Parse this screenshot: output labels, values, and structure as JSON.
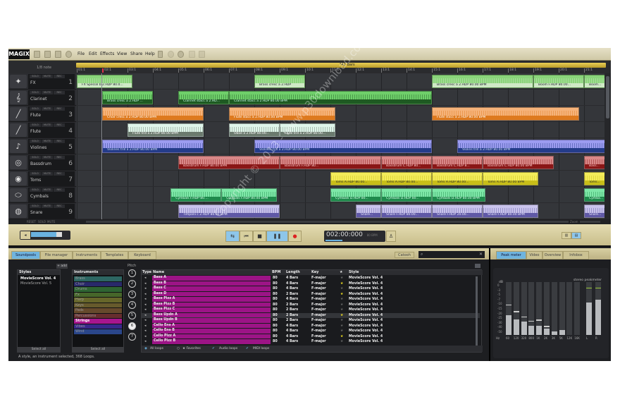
{
  "app": {
    "logo": "MAGIX",
    "menu": [
      "File",
      "Edit",
      "Effects",
      "View",
      "Share",
      "Help"
    ]
  },
  "ruler": {
    "grid_label": "1/8 note",
    "length_label": "*42 Bars",
    "ticks": [
      "01:1",
      "02:1",
      "03:1",
      "04:1",
      "05:1",
      "06:1",
      "07:1",
      "08:1",
      "09:1",
      "10:1",
      "11:1",
      "12:1",
      "13:1",
      "14:1",
      "15:1",
      "16:1",
      "17:1",
      "18:1",
      "19:1",
      "20:1",
      "21:1"
    ]
  },
  "track_buttons": {
    "solo": "SOLO",
    "mute": "MUTE",
    "rec": "REC"
  },
  "tracks": [
    {
      "num": "1",
      "name": "FX",
      "icon": "fx-icon",
      "glyph": "✦",
      "color": "#8ad47a",
      "label_color": "#cfe9c6",
      "text_color": "#223",
      "clips": [
        {
          "start": 0,
          "len": 2.2,
          "label": "FX Special b 2.HDP  80.0..."
        },
        {
          "start": 7,
          "len": 2,
          "label": "Brass cresc a 2.HDP"
        },
        {
          "start": 14,
          "len": 4,
          "label": "Brass cresc a 2.HDP  80.00 BPM"
        },
        {
          "start": 18,
          "len": 2,
          "label": "Boom F.HDP  80.00..."
        },
        {
          "start": 20,
          "len": 1,
          "label": "Boom..."
        }
      ]
    },
    {
      "num": "2",
      "name": "Clarinet",
      "icon": "clarinet-icon",
      "glyph": "𝄞",
      "color": "#6fcf6a",
      "label_color": "#1e5a22",
      "text_color": "#cfe",
      "clips": [
        {
          "start": 1,
          "len": 2,
          "label": "Brass cresc a 2.HDP ..."
        },
        {
          "start": 4,
          "len": 2,
          "label": "Clarinet stacc a 2.HD..."
        },
        {
          "start": 6,
          "len": 8,
          "label": "Clarinet stacc a 2.HDP  80.00 BPM"
        }
      ]
    },
    {
      "num": "3",
      "name": "Flute",
      "icon": "flute-icon",
      "glyph": "╱",
      "color": "#f6b37a",
      "label_color": "#de7a1e",
      "text_color": "#fff",
      "clips": [
        {
          "start": 1,
          "len": 4,
          "label": "Choir cresc a 2.HDP  80.00 BPM"
        },
        {
          "start": 6,
          "len": 4.2,
          "label": "Flute stacc a 2.HDP  80.00 BPM"
        },
        {
          "start": 14,
          "len": 5.8,
          "label": "Flute stacc a 2.HDP  80.00 BPM"
        }
      ]
    },
    {
      "num": "4",
      "name": "Flute",
      "icon": "flute-icon",
      "glyph": "╱",
      "color": "#dff5ea",
      "label_color": "#6b7a6e",
      "text_color": "#fff",
      "clips": [
        {
          "start": 2,
          "len": 3,
          "label": "Flute trill a 2.HDP  80.00 BPM"
        },
        {
          "start": 6,
          "len": 2,
          "label": "Oboe a 2.HDP  80.00..."
        },
        {
          "start": 8,
          "len": 2.2,
          "label": "Flute trill a 2.HDP  80.00..."
        }
      ]
    },
    {
      "num": "5",
      "name": "Violines",
      "icon": "violin-icon",
      "glyph": "♪",
      "color": "#9c9cf0",
      "label_color": "#243c8a",
      "text_color": "#cde",
      "clips": [
        {
          "start": 1,
          "len": 4,
          "label": "Violines trill a 2.HDP  80.00 BPM"
        },
        {
          "start": 7,
          "len": 7,
          "label": "Violines trill a 2.HDP  80.00 BPM"
        },
        {
          "start": 15,
          "len": 6,
          "label": "Violins trill a 2.HDP  80.00 BPM"
        }
      ]
    },
    {
      "num": "6",
      "name": "Bassdrum",
      "icon": "drumkit-icon",
      "glyph": "◎",
      "color": "#d98888",
      "label_color": "#8a1616",
      "text_color": "#fcc",
      "clips": [
        {
          "start": 4,
          "len": 4,
          "label": "Bassdrum F.HDP  80.00 BPM"
        },
        {
          "start": 8,
          "len": 4,
          "label": "Bassdrum F.HDP  80..."
        },
        {
          "start": 12,
          "len": 2,
          "label": "Bassdrum C.HDP  80..."
        },
        {
          "start": 14,
          "len": 2,
          "label": "Bassdrum C.HDP  8..."
        },
        {
          "start": 16,
          "len": 2.8,
          "label": "Bassdrum C.HDP  80.00 BPM"
        },
        {
          "start": 20,
          "len": 1,
          "label": "Bass..."
        }
      ]
    },
    {
      "num": "7",
      "name": "Toms",
      "icon": "tom-drum-icon",
      "glyph": "◉",
      "color": "#f3ec5a",
      "label_color": "#c8be18",
      "text_color": "#333",
      "clips": [
        {
          "start": 10,
          "len": 2,
          "label": "Toms A.HDP  80.00..."
        },
        {
          "start": 12,
          "len": 2,
          "label": "Toms A.HDP  80.00..."
        },
        {
          "start": 14,
          "len": 2,
          "label": "Toms A.HDP  80.00..."
        },
        {
          "start": 16,
          "len": 2.2,
          "label": "Toms A.HDP  80.00 BPM"
        },
        {
          "start": 20,
          "len": 1,
          "label": "Toms..."
        }
      ]
    },
    {
      "num": "8",
      "name": "Cymbals",
      "icon": "cymbal-icon",
      "glyph": "⬭",
      "color": "#7ee8a8",
      "label_color": "#1f8a4c",
      "text_color": "#dfe",
      "clips": [
        {
          "start": 3.7,
          "len": 2,
          "label": "Cymbals F.HDP  80...."
        },
        {
          "start": 5.7,
          "len": 2.2,
          "label": "Cymbals F.HDP  80.00 BPM"
        },
        {
          "start": 10,
          "len": 2,
          "label": "Cymbals D.HDP  80..."
        },
        {
          "start": 12,
          "len": 2,
          "label": "Cymbals D.HDP  80..."
        },
        {
          "start": 14,
          "len": 2.1,
          "label": "Cymbals D.HDP  80.00 BPM"
        },
        {
          "start": 20,
          "len": 1,
          "label": "Cymba..."
        }
      ]
    },
    {
      "num": "9",
      "name": "Snare",
      "icon": "snare-icon",
      "glyph": "◍",
      "color": "#c9c3ec",
      "label_color": "#5f58a6",
      "text_color": "#eef",
      "clips": [
        {
          "start": 4,
          "len": 4,
          "label": "Timpani c 2.HDP  80.00 BPM"
        },
        {
          "start": 11,
          "len": 1,
          "label": "Snare..."
        },
        {
          "start": 12,
          "len": 2,
          "label": "Snare F.HDP  80.00..."
        },
        {
          "start": 14,
          "len": 2,
          "label": "Snare F.HDP  20.00..."
        },
        {
          "start": 16,
          "len": 2.2,
          "label": "Snare F.HDP  80.00 BPM"
        },
        {
          "start": 20,
          "len": 1,
          "label": "Snare..."
        }
      ]
    }
  ],
  "arr_footer": {
    "reset": "RESET",
    "solo": "SOLO",
    "mute": "MUTE",
    "zoom": "Zoom"
  },
  "transport": {
    "time": "002:00:000",
    "bpm": "80 BPM"
  },
  "bottom_tabs": [
    "Soundpools",
    "File manager",
    "Instruments",
    "Templates",
    "Keyboard"
  ],
  "right_tabs": [
    "Peak meter",
    "Video",
    "Overview",
    "Infobox"
  ],
  "catooh": "Catooh",
  "search": {
    "placeholder": ""
  },
  "styles": {
    "header": "Styles",
    "add": "+ add",
    "items": [
      "MovieScore Vol. 4",
      "MovieScore Vol. 5"
    ],
    "select_all": "Select all"
  },
  "instruments": {
    "header": "Instruments",
    "select_all": "Select all",
    "items": [
      {
        "name": "Brass",
        "color": "#2d6662"
      },
      {
        "name": "Choir",
        "color": "#29296a"
      },
      {
        "name": "Drums",
        "color": "#2e6432"
      },
      {
        "name": "Fx",
        "color": "#46662a"
      },
      {
        "name": "Harp",
        "color": "#66662a"
      },
      {
        "name": "Keys",
        "color": "#665a2c"
      },
      {
        "name": "Pads",
        "color": "#664a2c"
      },
      {
        "name": "Percussions",
        "color": "#662e2e"
      },
      {
        "name": "Strings",
        "color": "#a8168e"
      },
      {
        "name": "Vibes",
        "color": "#38288a"
      },
      {
        "name": "Wind",
        "color": "#2a468a"
      }
    ],
    "selected": "Strings"
  },
  "pitch": {
    "label": "Pitch",
    "values": [
      "1",
      "2",
      "3",
      "4",
      "5",
      "6",
      "7"
    ],
    "selected": "6"
  },
  "loops_table": {
    "headers": {
      "type": "Type",
      "name": "Name",
      "bpm": "BPM",
      "length": "Length",
      "key": "Key",
      "fav": "★",
      "style": "Style"
    },
    "rows": [
      {
        "name": "Bass A",
        "bpm": "80",
        "length": "4 Bars",
        "key": "F-major",
        "fav": false,
        "style": "MovieScore Vol. 4"
      },
      {
        "name": "Bass B",
        "bpm": "80",
        "length": "4 Bars",
        "key": "F-major",
        "fav": true,
        "style": "MovieScore Vol. 4"
      },
      {
        "name": "Bass C",
        "bpm": "80",
        "length": "4 Bars",
        "key": "F-major",
        "fav": false,
        "style": "MovieScore Vol. 4"
      },
      {
        "name": "Bass D",
        "bpm": "80",
        "length": "2 Bars",
        "key": "F-major",
        "fav": true,
        "style": "MovieScore Vol. 4"
      },
      {
        "name": "Bass Pizz A",
        "bpm": "80",
        "length": "4 Bars",
        "key": "F-major",
        "fav": false,
        "style": "MovieScore Vol. 4"
      },
      {
        "name": "Bass Pizz B",
        "bpm": "80",
        "length": "2 Bars",
        "key": "F-major",
        "fav": false,
        "style": "MovieScore Vol. 4"
      },
      {
        "name": "Bass Pizz C",
        "bpm": "80",
        "length": "2 Bars",
        "key": "F-major",
        "fav": false,
        "style": "MovieScore Vol. 4"
      },
      {
        "name": "Bass Updn A",
        "bpm": "80",
        "length": "2 Bars",
        "key": "F-major",
        "fav": true,
        "style": "MovieScore Vol. 4",
        "selected": true
      },
      {
        "name": "Bass Updn B",
        "bpm": "80",
        "length": "2 Bars",
        "key": "F-major",
        "fav": false,
        "style": "MovieScore Vol. 4"
      },
      {
        "name": "Cello Ens A",
        "bpm": "80",
        "length": "4 Bars",
        "key": "F-major",
        "fav": false,
        "style": "MovieScore Vol. 4"
      },
      {
        "name": "Cello Ens B",
        "bpm": "80",
        "length": "4 Bars",
        "key": "F-major",
        "fav": false,
        "style": "MovieScore Vol. 4"
      },
      {
        "name": "Cello Pizz A",
        "bpm": "80",
        "length": "4 Bars",
        "key": "F-major",
        "fav": true,
        "style": "MovieScore Vol. 4"
      },
      {
        "name": "Cello Pizz B",
        "bpm": "80",
        "length": "4 Bars",
        "key": "F-major",
        "fav": false,
        "style": "MovieScore Vol. 4"
      }
    ],
    "filters": {
      "all_loops": "All loops",
      "favorites": "★ Favorites",
      "audio_loops": "Audio loops",
      "midi_loops": "MIDI loops"
    }
  },
  "status": "A style, an instrument selected, 368 Loops.",
  "peakmeter": {
    "title": "stereo peakmeter",
    "db_label": "dB",
    "hz_label": "Hz",
    "db_ticks": [
      "0",
      "-3",
      "-5",
      "-7",
      "-10",
      "-15",
      "-20",
      "-25",
      "-30",
      "-40",
      "-50"
    ],
    "bands": [
      {
        "label": "60",
        "level": 0.37,
        "peak": 0.58
      },
      {
        "label": "120",
        "level": 0.3,
        "peak": 0.45
      },
      {
        "label": "320",
        "level": 0.25,
        "peak": 0.35
      },
      {
        "label": "800",
        "level": 0.17,
        "peak": 0.27
      },
      {
        "label": "1K",
        "level": 0.18,
        "peak": 0.29
      },
      {
        "label": "2K",
        "level": 0.12,
        "peak": 0.17
      },
      {
        "label": "3K",
        "level": 0.07,
        "peak": null
      },
      {
        "label": "5K",
        "level": 0.09,
        "peak": null
      },
      {
        "label": "12K",
        "level": 0,
        "peak": null
      },
      {
        "label": "16K",
        "level": 0,
        "peak": null
      }
    ],
    "channels": [
      {
        "label": "L",
        "level": 0.61,
        "peak": 0.9
      },
      {
        "label": "R",
        "level": 0.67,
        "peak": 0.9
      }
    ]
  },
  "watermark": "Copyright © 2013 - www.p30download.com"
}
